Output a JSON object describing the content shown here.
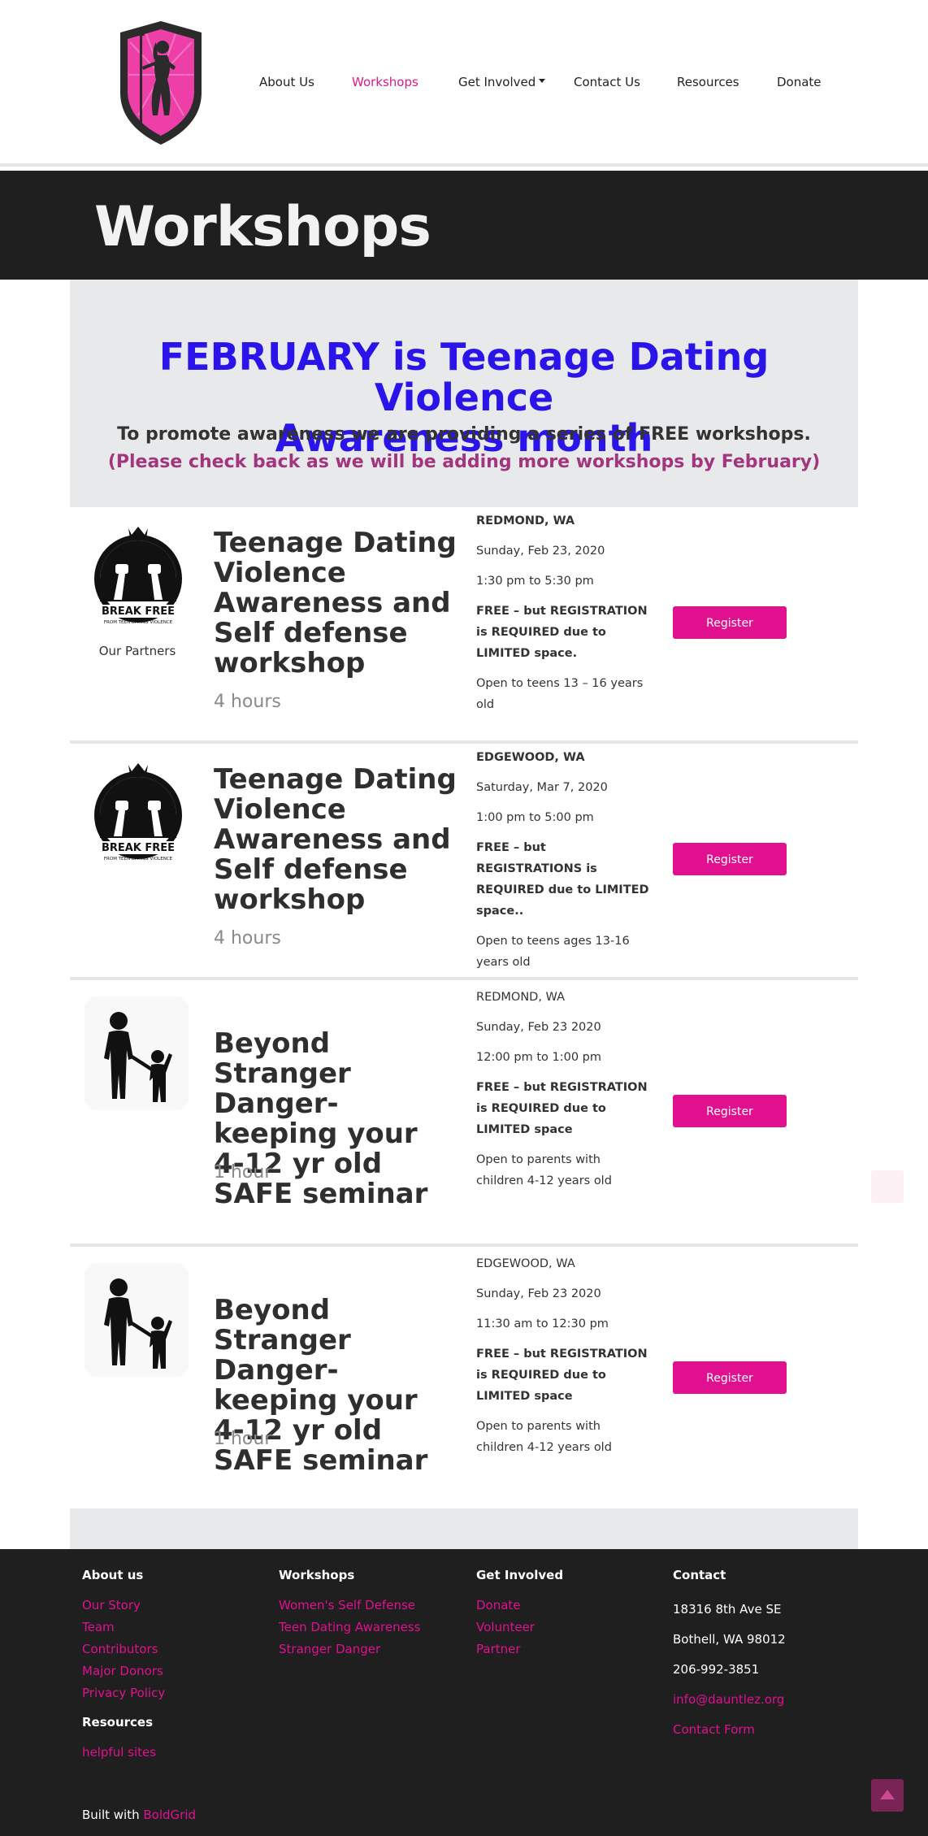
{
  "nav": {
    "items": [
      {
        "label": "About Us"
      },
      {
        "label": "Workshops"
      },
      {
        "label": "Get Involved"
      },
      {
        "label": "Contact Us"
      },
      {
        "label": "Resources"
      },
      {
        "label": "Donate"
      }
    ],
    "active": "Workshops"
  },
  "banner": {
    "title": "Workshops"
  },
  "intro": {
    "headline_line1": "FEBRUARY is Teenage Dating Violence",
    "headline_line2": "Awareness month",
    "subheading": "To promote awareness we are providing a series of FREE workshops.",
    "note": "(Please check back as we will be adding more workshops by February)"
  },
  "workshops": [
    {
      "icon": "break-free-logo",
      "partner_label": "Our Partners",
      "title": "Teenage Dating Violence Awareness and Self defense workshop",
      "duration": "4 hours",
      "location": "REDMOND, WA",
      "date": "Sunday, Feb 23, 2020",
      "time": "1:30 pm to 5:30 pm",
      "free_note": "FREE – but REGISTRATION is REQUIRED due to LIMITED space.",
      "audience": "Open to teens 13  – 16 years old",
      "register_label": "Register"
    },
    {
      "icon": "break-free-logo",
      "title": "Teenage Dating Violence Awareness and Self defense workshop",
      "duration": "4 hours",
      "location": "EDGEWOOD, WA",
      "date": "Saturday, Mar 7, 2020",
      "time": "1:00 pm to 5:00 pm",
      "free_note": "FREE – but REGISTRATIONS is REQUIRED due to LIMITED space..",
      "audience": "Open to teens ages 13-16 years old",
      "register_label": "Register"
    },
    {
      "icon": "parent-child-icon",
      "title": "Beyond Stranger Danger- keeping your 4-12 yr old SAFE seminar",
      "duration": "1 hour",
      "location": "REDMOND, WA",
      "date": "Sunday, Feb 23 2020",
      "time": "12:00 pm to 1:00 pm",
      "free_note": "FREE – but REGISTRATION is REQUIRED due to LIMITED space",
      "audience": "Open to parents with children 4-12 years old",
      "register_label": "Register"
    },
    {
      "icon": "parent-child-icon",
      "title": "Beyond Stranger Danger- keeping your 4-12 yr old SAFE seminar",
      "duration": "1 hour",
      "location": "EDGEWOOD, WA",
      "date": "Sunday, Feb 23 2020",
      "time": "11:30 am to 12:30 pm",
      "free_note": "FREE – but REGISTRATION is REQUIRED due to LIMITED space",
      "audience": "Open to parents with children 4-12 years old",
      "register_label": "Register"
    }
  ],
  "footer": {
    "about": {
      "heading": "About us",
      "links": [
        "Our Story",
        "Team",
        "Contributors",
        "Major Donors",
        "Privacy Policy"
      ]
    },
    "resources": {
      "heading": "Resources",
      "links": [
        "helpful sites"
      ]
    },
    "workshops": {
      "heading": "Workshops",
      "links": [
        "Women's Self Defense",
        "Teen Dating Awareness",
        "Stranger Danger"
      ]
    },
    "get_involved": {
      "heading": "Get Involved",
      "links": [
        "Donate",
        "Volunteer",
        "Partner"
      ]
    },
    "contact": {
      "heading": "Contact",
      "address1": "18316 8th Ave SE",
      "address2": "Bothell, WA 98012",
      "phone": "206-992-3851",
      "email": "info@dauntlez.org",
      "form": "Contact Form"
    },
    "built_with": "Built with",
    "built_with_link": "BoldGrid"
  },
  "colors": {
    "accent": "#e0108f",
    "headline_blue": "#2a14ea",
    "note_purple": "#a3357e",
    "dark": "#1f1f20",
    "panel": "#e8e9eb"
  }
}
